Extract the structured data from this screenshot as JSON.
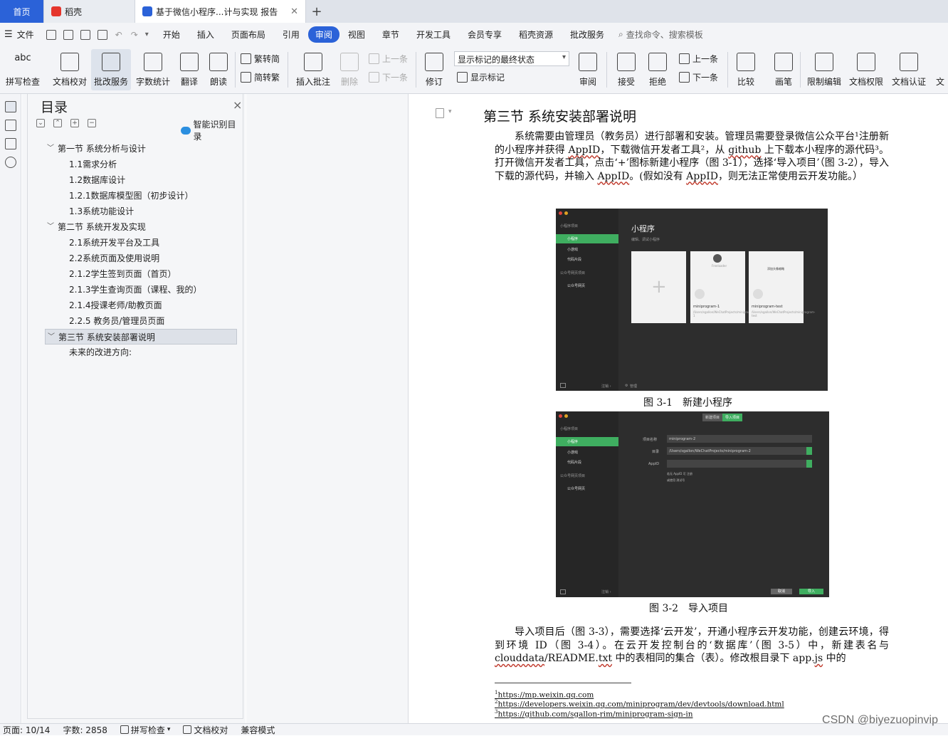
{
  "tabs": {
    "home": "首页",
    "daoke": "稻壳",
    "doc": "基于微信小程序...计与实现 报告",
    "new_tab": "+"
  },
  "menubar": {
    "file": "文件",
    "items": [
      "开始",
      "插入",
      "页面布局",
      "引用",
      "审阅",
      "视图",
      "章节",
      "开发工具",
      "会员专享",
      "稻壳资源",
      "批改服务"
    ],
    "active": "审阅",
    "search": "查找命令、搜索模板"
  },
  "ribbon": {
    "spell_check": "拼写检查",
    "doc_proof": "文档校对",
    "review_service": "批改服务",
    "word_count": "字数统计",
    "translate": "翻译",
    "read_aloud": "朗读",
    "trad_to_simp": "繁转简",
    "simp_to_trad": "简转繁",
    "insert_comment": "插入批注",
    "delete": "删除",
    "prev": "上一条",
    "next": "下一条",
    "track": "修订",
    "markup_state": "显示标记的最终状态",
    "show_markup": "显示标记",
    "review": "审阅",
    "accept": "接受",
    "reject": "拒绝",
    "prev2": "上一条",
    "next2": "下一条",
    "compare": "比较",
    "pen": "画笔",
    "restrict_edit": "限制编辑",
    "doc_permission": "文档权限",
    "doc_cert": "文档认证",
    "doc_more": "文"
  },
  "toc": {
    "title": "目录",
    "close": "×",
    "smart_toc": "智能识别目录",
    "items": [
      {
        "label": "第一节 系统分析与设计",
        "level": 1,
        "expanded": true
      },
      {
        "label": "1.1需求分析",
        "level": 2
      },
      {
        "label": "1.2数据库设计",
        "level": 2
      },
      {
        "label": "1.2.1数据库模型图（初步设计）",
        "level": 2
      },
      {
        "label": "1.3系统功能设计",
        "level": 2
      },
      {
        "label": "第二节 系统开发及实现",
        "level": 1,
        "expanded": true
      },
      {
        "label": "2.1系统开发平台及工具",
        "level": 2
      },
      {
        "label": "2.2系统页面及使用说明",
        "level": 2
      },
      {
        "label": "2.1.2学生签到页面（首页）",
        "level": 2
      },
      {
        "label": "2.1.3学生查询页面（课程、我的）",
        "level": 2
      },
      {
        "label": "2.1.4授课老师/助教页面",
        "level": 2
      },
      {
        "label": "2.2.5 教务员/管理员页面",
        "level": 2
      },
      {
        "label": "第三节 系统安装部署说明",
        "level": 1,
        "expanded": true,
        "selected": true
      },
      {
        "label": "未来的改进方向:",
        "level": 2
      }
    ]
  },
  "document": {
    "heading": "第三节 系统安装部署说明",
    "para1_a": "系统需要由管理员（教务员）进行部署和安装。管理员需要登录微信公众平台¹注册新的小程序并获得 ",
    "para1_appid": "AppID",
    "para1_b": "，下载微信开发者工具²，从 ",
    "para1_github": "github",
    "para1_c": " 上下载本小程序的源代码³。打开微信开发者工具，点击‘+’图标新建小程序（图 3-1），选择‘导入项目’（图 3-2），导入下载的源代码，并输入 ",
    "para1_appid2": "AppID",
    "para1_d": "。(假如没有 ",
    "para1_appid3": "AppID",
    "para1_e": "，则无法正常使用云开发功能。）",
    "fig1_caption": "图 3-1　新建小程序",
    "fig2_caption": "图 3-2　导入项目",
    "para2_a": "导入项目后（图 3-3），需要选择‘云开发’，开通小程序云开发功能，创建云环境，得到环境 ID（图 3-4）。在云开发控制台的‘数据库’（图 3-5）中，新建表名与 ",
    "para2_cloud": "clouddata",
    "para2_b": "/README.",
    "para2_txt": "txt",
    "para2_c": " 中的表相同的集合（表）。修改根目录下 app.",
    "para2_js": "js",
    "para2_d": " 中的",
    "footnotes": [
      {
        "num": "1",
        "url": "https://mp.weixin.qq.com"
      },
      {
        "num": "2",
        "url": "https://developers.weixin.qq.com/miniprogram/dev/devtools/download.html"
      },
      {
        "num": "3",
        "url": "https://github.com/sgallon-rim/miniprogram-sign-in"
      }
    ]
  },
  "fig1": {
    "sidebar_header": "小程序项目",
    "sidebar_selected": "小程序",
    "sidebar_items": [
      "小游戏",
      "代码片段"
    ],
    "sidebar_header2": "公众号网页项目",
    "sidebar_item2": "公众号网页",
    "title": "小程序",
    "subtitle": "编辑、调试小程序",
    "card1_name": "miniprogram-1",
    "card1_path": "/Users/sgallon/WeChatProjects/miniprogram-1",
    "card2_name": "miniprogram-test",
    "card2_path": "/Users/sgallon/WeChatProjects/miniprogram-test",
    "card2_tag": "添加头像缩略",
    "card1_tag": "Freeloader",
    "logout": "注销 ›",
    "manage": "管理"
  },
  "fig2": {
    "seg_new": "新建项目",
    "seg_import": "导入项目",
    "label_name": "项目名称",
    "value_name": "miniprogram-2",
    "label_dir": "目录",
    "value_dir": "/Users/sgallon/WeChatProjects/miniprogram-2",
    "label_appid": "AppID",
    "hint1": "若无 AppID 可 注册",
    "hint2": "或使用 测试号",
    "cancel": "取消",
    "import": "导入",
    "logout": "注销 ›"
  },
  "status": {
    "page": "页面: 10/14",
    "words": "字数: 2858",
    "spell": "拼写检查",
    "proof": "文档校对",
    "compat": "兼容模式"
  },
  "watermark": "CSDN @biyezuopinvip"
}
